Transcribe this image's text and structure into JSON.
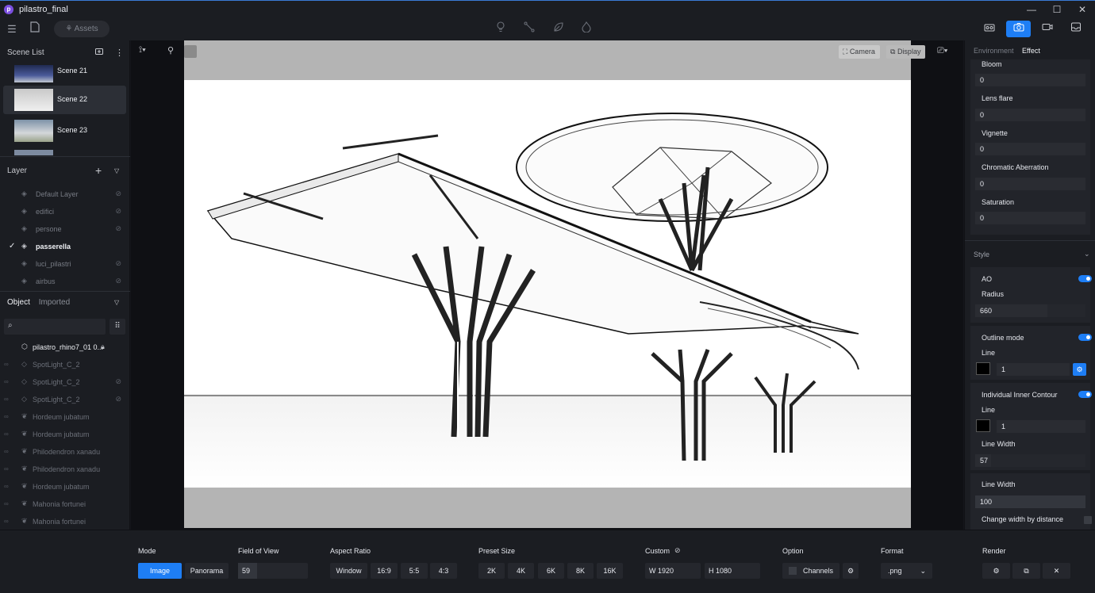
{
  "app": {
    "title": "pilastro_final",
    "logo_letter": "p"
  },
  "window_controls": {
    "minimize": "—",
    "maximize": "☐",
    "close": "✕"
  },
  "toolbar": {
    "assets_label": "Assets"
  },
  "scene_list": {
    "title": "Scene List",
    "scenes": [
      {
        "name": "Scene 21"
      },
      {
        "name": "Scene 22"
      },
      {
        "name": "Scene 23"
      }
    ]
  },
  "layers": {
    "title": "Layer",
    "items": [
      {
        "name": "Default Layer"
      },
      {
        "name": "edifici"
      },
      {
        "name": "persone"
      },
      {
        "name": "passerella"
      },
      {
        "name": "luci_pilastri"
      },
      {
        "name": "airbus"
      }
    ]
  },
  "objects": {
    "tabs": [
      "Object",
      "Imported"
    ],
    "items": [
      {
        "name": "pilastro_rhino7_01 0..."
      },
      {
        "name": "SpotLight_C_2"
      },
      {
        "name": "SpotLight_C_2"
      },
      {
        "name": "SpotLight_C_2"
      },
      {
        "name": "Hordeum jubatum"
      },
      {
        "name": "Hordeum jubatum"
      },
      {
        "name": "Philodendron xanadu"
      },
      {
        "name": "Philodendron xanadu"
      },
      {
        "name": "Hordeum jubatum"
      },
      {
        "name": "Mahonia fortunei"
      },
      {
        "name": "Mahonia fortunei"
      }
    ]
  },
  "viewport": {
    "camera_label": "Camera",
    "display_label": "Display"
  },
  "right_panel": {
    "tabs": [
      "Environment",
      "Effect"
    ],
    "effects": [
      {
        "label": "Bloom",
        "value": "0"
      },
      {
        "label": "Lens flare",
        "value": "0"
      },
      {
        "label": "Vignette",
        "value": "0"
      },
      {
        "label": "Chromatic Aberration",
        "value": "0"
      },
      {
        "label": "Saturation",
        "value": "0"
      }
    ],
    "style": {
      "title": "Style",
      "ao_label": "AO",
      "radius_label": "Radius",
      "radius_value": "660",
      "outline_label": "Outline mode",
      "line_label": "Line",
      "line_value": "1",
      "inner_contour_label": "Individual Inner Contour",
      "line2_label": "Line",
      "line2_value": "1",
      "line_width_label": "Line Width",
      "line_width_value": "57",
      "line_width2_label": "Line Width",
      "line_width2_value": "100",
      "change_width_label": "Change width by distance"
    }
  },
  "bottom": {
    "mode": {
      "label": "Mode",
      "options": [
        "Image",
        "Panorama"
      ]
    },
    "fov": {
      "label": "Field of View",
      "value": "59"
    },
    "aspect": {
      "label": "Aspect Ratio",
      "options": [
        "Window",
        "16:9",
        "5:5",
        "4:3"
      ]
    },
    "preset": {
      "label": "Preset Size",
      "options": [
        "2K",
        "4K",
        "6K",
        "8K",
        "16K"
      ]
    },
    "custom": {
      "label": "Custom",
      "w_label": "W",
      "w_value": "1920",
      "h_label": "H",
      "h_value": "1080"
    },
    "option": {
      "label": "Option",
      "channels_label": "Channels"
    },
    "format": {
      "label": "Format",
      "value": ".png"
    },
    "render": {
      "label": "Render"
    }
  },
  "colors": {
    "accent": "#1e7ef5",
    "panel": "#1b1d22",
    "viewport_bg": "#0f1014"
  }
}
